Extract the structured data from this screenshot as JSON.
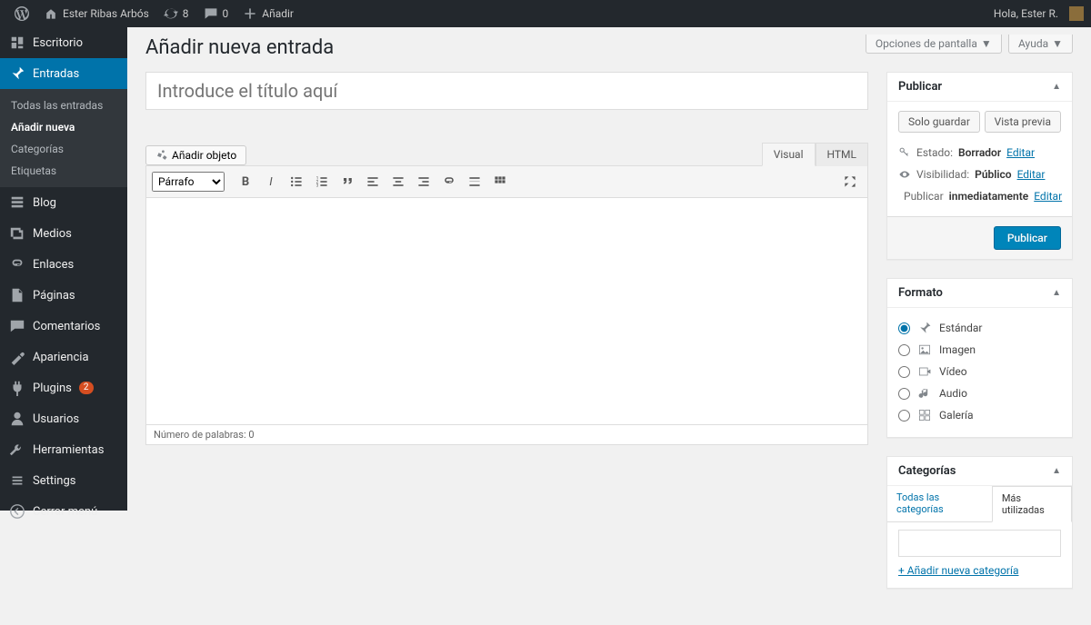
{
  "adminbar": {
    "site_name": "Ester Ribas Arbós",
    "updates_count": "8",
    "comments_count": "0",
    "add_new": "Añadir",
    "greeting": "Hola, Ester R."
  },
  "screen_options": {
    "label": "Opciones de pantalla"
  },
  "help": {
    "label": "Ayuda"
  },
  "page_title": "Añadir nueva entrada",
  "title_placeholder": "Introduce el título aquí",
  "media_button": "Añadir objeto",
  "editor_tabs": {
    "visual": "Visual",
    "html": "HTML"
  },
  "paragraph_select": "Párrafo",
  "word_count": "Número de palabras: 0",
  "sidebar": {
    "dashboard": "Escritorio",
    "posts": "Entradas",
    "posts_sub": {
      "all": "Todas las entradas",
      "add": "Añadir nueva",
      "cat": "Categorías",
      "tags": "Etiquetas"
    },
    "blog": "Blog",
    "media": "Medios",
    "links": "Enlaces",
    "pages": "Páginas",
    "comments": "Comentarios",
    "appearance": "Apariencia",
    "plugins": "Plugins",
    "plugins_badge": "2",
    "users": "Usuarios",
    "tools": "Herramientas",
    "settings_en": "Settings",
    "collapse": "Cerrar menú"
  },
  "publish_box": {
    "title": "Publicar",
    "save_draft": "Solo guardar",
    "preview": "Vista previa",
    "status_label": "Estado:",
    "status_value": "Borrador",
    "visibility_label": "Visibilidad:",
    "visibility_value": "Público",
    "schedule_label": "Publicar",
    "schedule_value": "inmediatamente",
    "edit": "Editar",
    "publish_btn": "Publicar"
  },
  "format_box": {
    "title": "Formato",
    "standard": "Estándar",
    "image": "Imagen",
    "video": "Vídeo",
    "audio": "Audio",
    "gallery": "Galería"
  },
  "categories_box": {
    "title": "Categorías",
    "all_tab": "Todas las categorías",
    "most_tab": "Más utilizadas",
    "add_new": "+ Añadir nueva categoría"
  }
}
